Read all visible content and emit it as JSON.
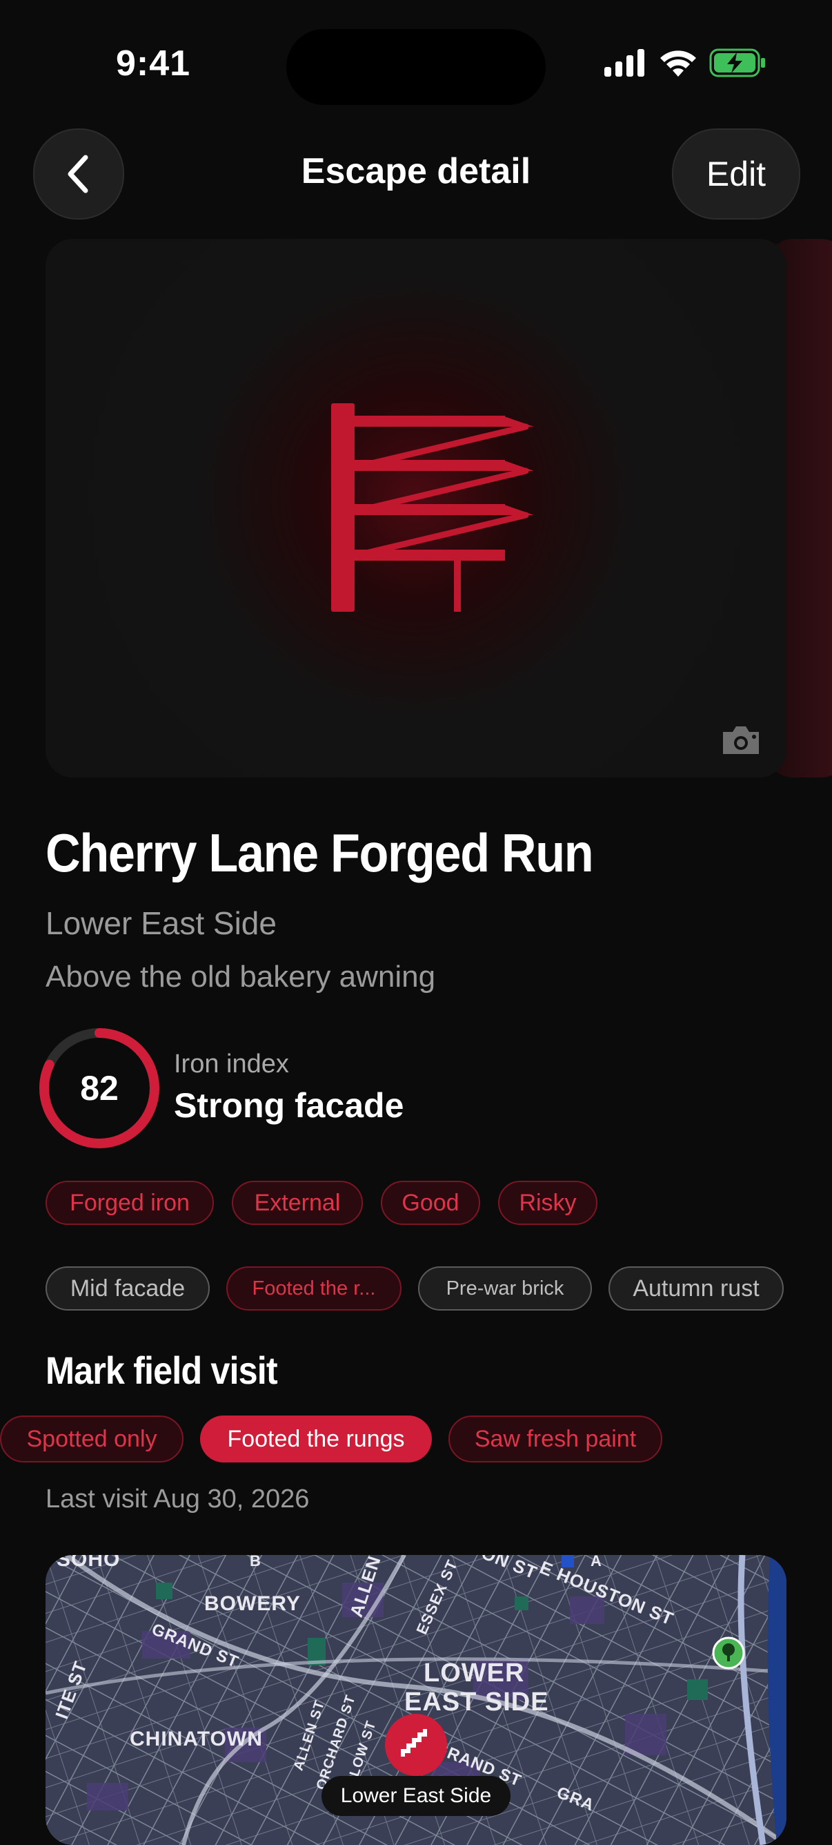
{
  "status_bar": {
    "time": "9:41"
  },
  "nav": {
    "title": "Escape detail",
    "edit_label": "Edit"
  },
  "escape": {
    "name": "Cherry Lane Forged Run",
    "neighborhood": "Lower East Side",
    "note": "Above the old bakery awning"
  },
  "iron_index": {
    "score": "82",
    "score_fraction": 0.82,
    "label": "Iron index",
    "rating": "Strong facade"
  },
  "tags_primary": [
    {
      "label": "Forged iron"
    },
    {
      "label": "External"
    },
    {
      "label": "Good"
    },
    {
      "label": "Risky"
    }
  ],
  "tags_secondary": [
    {
      "label": "Mid facade"
    },
    {
      "label": "Footed the r..."
    },
    {
      "label": "Pre-war brick"
    },
    {
      "label": "Autumn rust"
    }
  ],
  "field_visit": {
    "title": "Mark field visit",
    "options": [
      {
        "label": "Spotted only",
        "selected": false
      },
      {
        "label": "Footed the rungs",
        "selected": true
      },
      {
        "label": "Saw fresh paint",
        "selected": false
      }
    ],
    "last_visit": "Last visit Aug 30, 2026"
  },
  "map": {
    "pin_label": "Lower East Side",
    "labels": [
      "SOHO",
      "BOWERY",
      "GRAND ST",
      "CHINATOWN",
      "ALLEN",
      "ESSEX ST",
      "E HOUSTON ST",
      "LOWER",
      "EAST SIDE",
      "ALLEN ST",
      "ORCHARD ST",
      "LUDLOW ST",
      "GRAND ST",
      "ITE ST",
      "B",
      "A",
      "ON ST",
      "GRA"
    ]
  },
  "colors": {
    "accent": "#d01d39",
    "background": "#0b0b0b",
    "muted_text": "#9b9b9b"
  }
}
